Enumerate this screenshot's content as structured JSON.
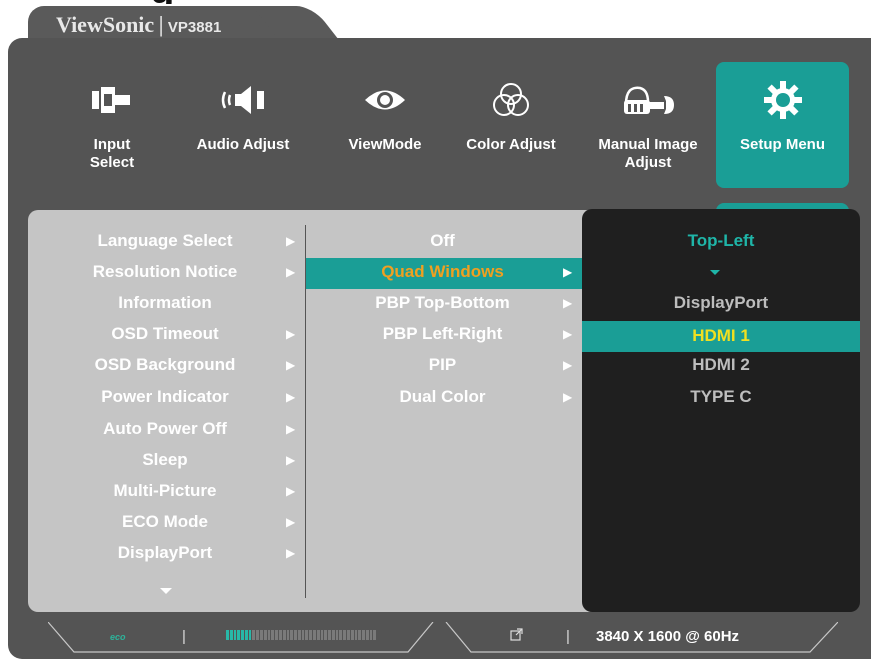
{
  "brand": {
    "logo": "ViewSonic",
    "separator": "|",
    "model": "VP3881"
  },
  "top_menu": [
    {
      "label": "Input\nSelect",
      "icon": "input-select-icon"
    },
    {
      "label": "Audio Adjust",
      "icon": "speaker-icon"
    },
    {
      "label": "ViewMode",
      "icon": "eye-icon"
    },
    {
      "label": "Color Adjust",
      "icon": "color-circles-icon"
    },
    {
      "label": "Manual Image\nAdjust",
      "icon": "hand-wrench-icon"
    },
    {
      "label": "Setup Menu",
      "icon": "gear-icon",
      "active": true
    }
  ],
  "setup_items": [
    {
      "label": "Language Select",
      "has_submenu": true
    },
    {
      "label": "Resolution Notice",
      "has_submenu": true
    },
    {
      "label": "Information",
      "has_submenu": false
    },
    {
      "label": "OSD Timeout",
      "has_submenu": true
    },
    {
      "label": "OSD Background",
      "has_submenu": true
    },
    {
      "label": "Power Indicator",
      "has_submenu": true
    },
    {
      "label": "Auto Power Off",
      "has_submenu": true
    },
    {
      "label": "Sleep",
      "has_submenu": true
    },
    {
      "label": "Multi-Picture",
      "has_submenu": true
    },
    {
      "label": "ECO Mode",
      "has_submenu": true
    },
    {
      "label": "DisplayPort",
      "has_submenu": true
    }
  ],
  "multi_picture_options": [
    {
      "label": "Off",
      "has_submenu": false
    },
    {
      "label": "Quad Windows",
      "has_submenu": true,
      "selected": true
    },
    {
      "label": "PBP Top-Bottom",
      "has_submenu": true
    },
    {
      "label": "PBP Left-Right",
      "has_submenu": true
    },
    {
      "label": "PIP",
      "has_submenu": true
    },
    {
      "label": "Dual Color",
      "has_submenu": true
    }
  ],
  "window_panel": {
    "header": "Top-Left",
    "sources": [
      {
        "label": "DisplayPort"
      },
      {
        "label": "HDMI 1",
        "selected": true
      },
      {
        "label": "HDMI 2"
      },
      {
        "label": "TYPE C"
      }
    ]
  },
  "status_bar": {
    "eco_label": "eco",
    "separator": "|",
    "resolution": "3840 X 1600 @ 60Hz",
    "brightness_level": 0.18
  },
  "colors": {
    "accent": "#1a9e96",
    "selected_text": "#f0d020",
    "highlight_text": "#f0a020",
    "panel_dark": "#1f1f1f",
    "panel_light": "#c5c5c5",
    "body": "#545454"
  }
}
